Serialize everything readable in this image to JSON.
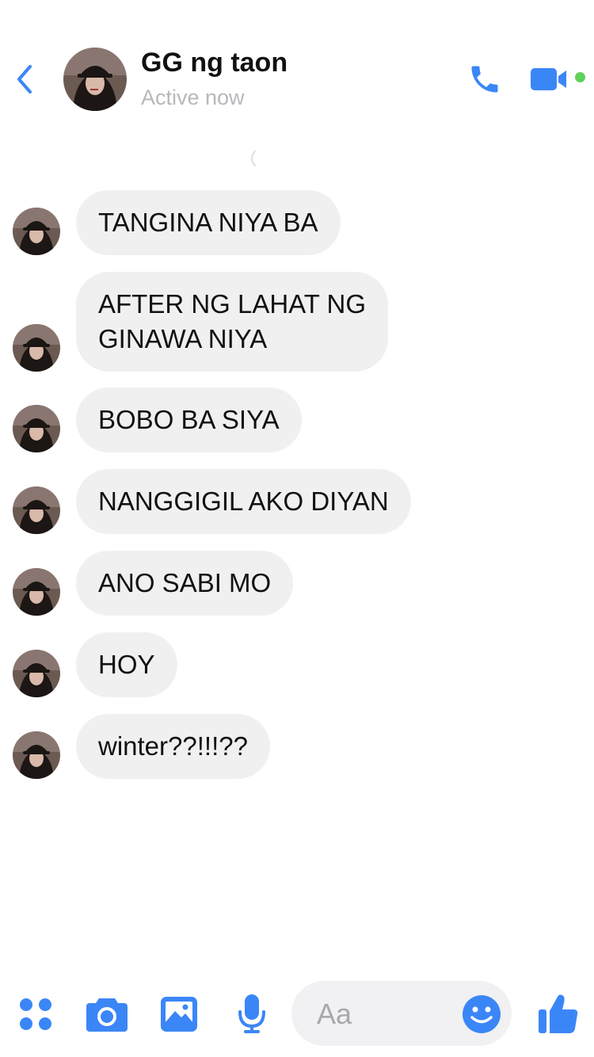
{
  "header": {
    "contact_name": "GG ng taon",
    "status": "Active now"
  },
  "messages": [
    {
      "text": "TANGINA NIYA BA"
    },
    {
      "text": "AFTER NG LAHAT NG\nGINAWA NIYA"
    },
    {
      "text": "BOBO BA SIYA"
    },
    {
      "text": "NANGGIGIL AKO DIYAN"
    },
    {
      "text": "ANO SABI MO"
    },
    {
      "text": "HOY"
    },
    {
      "text": "winter??!!!??"
    }
  ],
  "composer": {
    "placeholder": "Aa",
    "value": ""
  },
  "colors": {
    "accent": "#3b86f7",
    "online": "#5fd15a",
    "bubble": "#f0f0f0"
  },
  "icons": [
    "back-chevron-icon",
    "phone-icon",
    "video-camera-icon",
    "apps-icon",
    "camera-icon",
    "image-icon",
    "microphone-icon",
    "emoji-icon",
    "thumbs-up-icon"
  ]
}
